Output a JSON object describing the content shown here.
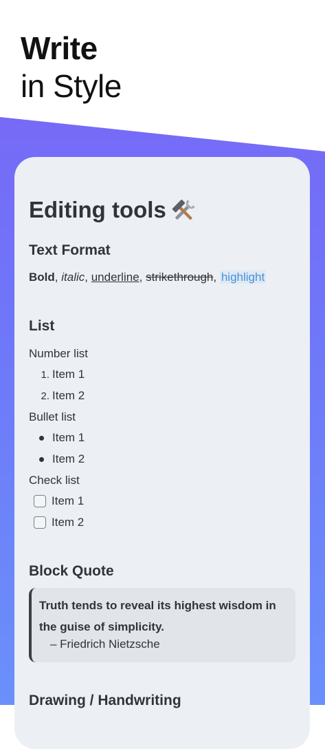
{
  "hero": {
    "line1": "Write",
    "line2": "in Style"
  },
  "card": {
    "title": "Editing tools",
    "title_icon": "hammer-and-wrench-icon",
    "text_format": {
      "heading": "Text Format",
      "bold": "Bold",
      "italic": "italic",
      "underline": "underline",
      "strike": "strikethrough",
      "highlight": "highlight",
      "separator": ", "
    },
    "list": {
      "heading": "List",
      "number_label": "Number list",
      "number_items": [
        {
          "marker": "1.",
          "text": "Item 1"
        },
        {
          "marker": "2.",
          "text": "Item 2"
        }
      ],
      "bullet_label": "Bullet list",
      "bullet_items": [
        "Item 1",
        "Item 2"
      ],
      "check_label": "Check list",
      "check_items": [
        "Item 1",
        "Item 2"
      ]
    },
    "block_quote": {
      "heading": "Block Quote",
      "text": "Truth tends to reveal its highest wisdom in the guise of simplicity.",
      "author": "–  Friedrich Nietzsche"
    },
    "drawing": {
      "heading": "Drawing / Handwriting"
    }
  },
  "colors": {
    "gradient_top": "#7a63f6",
    "gradient_bottom": "#6a90fb",
    "highlight_text": "#4a90d9",
    "highlight_bg": "#dde9f6"
  }
}
